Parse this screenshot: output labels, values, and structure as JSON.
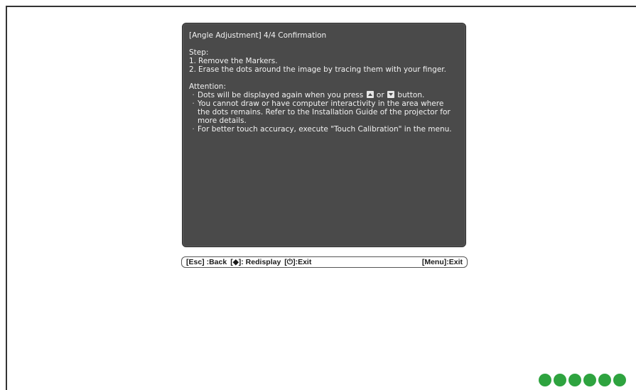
{
  "osd": {
    "title": "[Angle Adjustment]  4/4  Confirmation",
    "step_heading": "Step:",
    "steps": [
      {
        "num": "1.",
        "text": "Remove the Markers."
      },
      {
        "num": "2.",
        "text": "Erase the dots around the image by tracing them with your finger."
      }
    ],
    "attention_heading": "Attention:",
    "attention": [
      {
        "before": "Dots will be displayed again when you press ",
        "middle": " or ",
        "after": " button."
      },
      {
        "text": "You cannot draw or have computer interactivity in the area where the dots remains. Refer to the Installation Guide of the projector for more details."
      },
      {
        "text": "For better touch accuracy, execute \"Touch Calibration\" in the menu."
      }
    ],
    "up_key_icon": "up-arrow-key-icon",
    "down_key_icon": "down-arrow-key-icon",
    "panel_color": "#4a4a4a",
    "text_color": "#f2f2f2"
  },
  "guide": {
    "esc": "[Esc] :Back",
    "redisplay": "[◆]: Redisplay",
    "exit": "[⏻]:Exit",
    "menu": "[Menu]:Exit"
  },
  "decor": {
    "dot_color": "#2ea33f",
    "dot_count": 6
  }
}
